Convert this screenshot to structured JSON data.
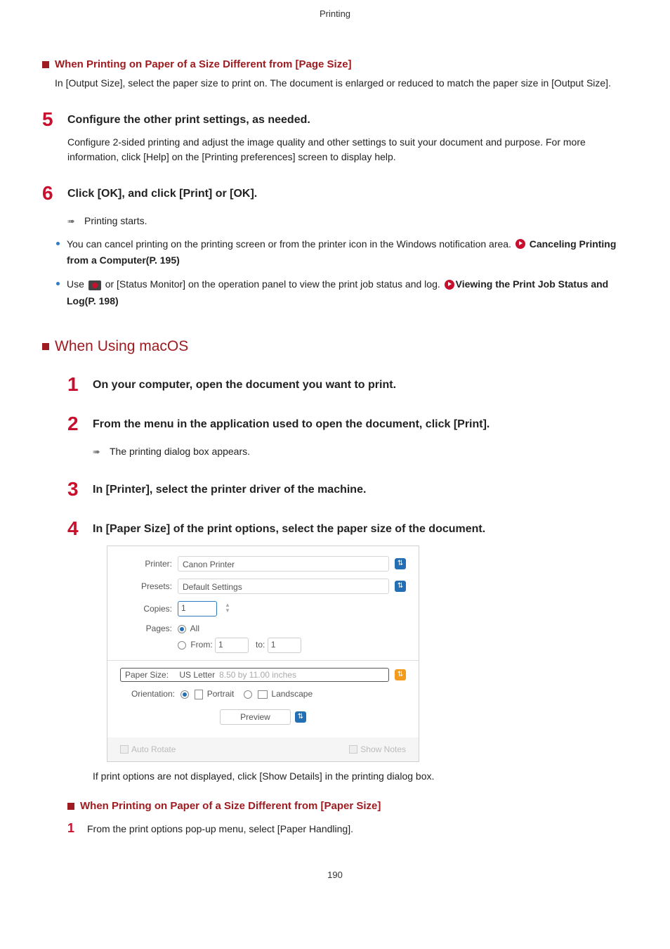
{
  "header": "Printing",
  "sub4": {
    "title": "When Printing on Paper of a Size Different from [Page Size]",
    "body": "In [Output Size], select the paper size to print on. The document is enlarged or reduced to match the paper size in [Output Size]."
  },
  "step5": {
    "num": "5",
    "title": "Configure the other print settings, as needed.",
    "body": "Configure 2-sided printing and adjust the image quality and other settings to suit your document and purpose. For more information, click [Help] on the [Printing preferences] screen to display help."
  },
  "step6": {
    "num": "6",
    "title": "Click [OK], and click [Print] or [OK].",
    "arrow": "Printing starts.",
    "bullet1a": "You can cancel printing on the printing screen or from the printer icon in the Windows notification area. ",
    "bullet1b": "Canceling Printing from a Computer(P. 195)",
    "bullet2a": "Use ",
    "bullet2b": " or [Status Monitor] on the operation panel to view the print job status and log. ",
    "bullet2c": "Viewing the Print Job Status and Log(P. 198)"
  },
  "macos": {
    "heading": "When Using macOS",
    "step1": {
      "num": "1",
      "title": "On your computer, open the document you want to print."
    },
    "step2": {
      "num": "2",
      "title": "From the menu in the application used to open the document, click [Print].",
      "arrow": "The printing dialog box appears."
    },
    "step3": {
      "num": "3",
      "title": "In [Printer], select the printer driver of the machine."
    },
    "step4": {
      "num": "4",
      "title": "In [Paper Size] of the print options, select the paper size of the document.",
      "body": "If print options are not displayed, click [Show Details] in the printing dialog box."
    }
  },
  "dlg": {
    "printer_label": "Printer:",
    "printer_value": "Canon Printer",
    "presets_label": "Presets:",
    "presets_value": "Default Settings",
    "copies_label": "Copies:",
    "copies_value": "1",
    "pages_label": "Pages:",
    "pages_all": "All",
    "pages_from": "From:",
    "pages_from_val": "1",
    "pages_to": "to:",
    "pages_to_val": "1",
    "papersize_label": "Paper Size:",
    "papersize_value": "US Letter",
    "papersize_dims": "8.50 by 11.00 inches",
    "orient_label": "Orientation:",
    "orient_portrait": "Portrait",
    "orient_landscape": "Landscape",
    "preview": "Preview",
    "auto_rotate": "Auto Rotate",
    "show_notes": "Show Notes"
  },
  "sub_paper": {
    "title": "When Printing on Paper of a Size Different from [Paper Size]",
    "substep_num": "1",
    "substep_body": "From the print options pop-up menu, select [Paper Handling]."
  },
  "page_number": "190"
}
